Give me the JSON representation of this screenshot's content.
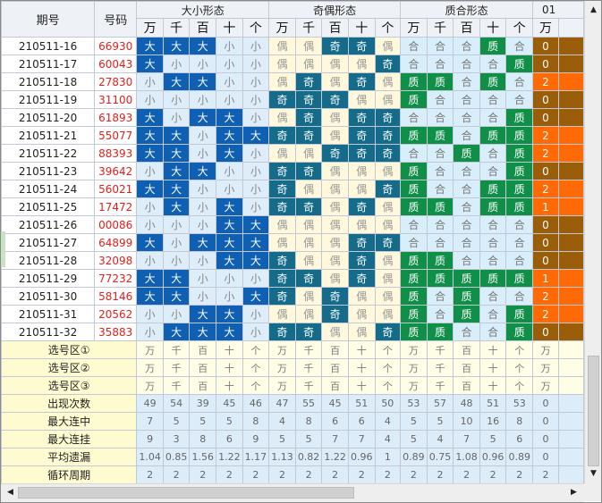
{
  "header": {
    "period": "期号",
    "number": "号码",
    "groups": [
      "大小形态",
      "奇偶形态",
      "质合形态",
      "01"
    ],
    "positions": [
      "万",
      "千",
      "百",
      "十",
      "个"
    ]
  },
  "rows": [
    {
      "p": "210511-16",
      "n": "66930",
      "dx": [
        "大",
        "大",
        "大",
        "小",
        "小"
      ],
      "jo": [
        "偶",
        "偶",
        "奇",
        "奇",
        "偶"
      ],
      "zh": [
        "合",
        "合",
        "合",
        "质",
        "合"
      ],
      "v": "0"
    },
    {
      "p": "210511-17",
      "n": "60043",
      "dx": [
        "大",
        "小",
        "小",
        "小",
        "小"
      ],
      "jo": [
        "偶",
        "偶",
        "偶",
        "偶",
        "奇"
      ],
      "zh": [
        "合",
        "合",
        "合",
        "合",
        "质"
      ],
      "v": "0"
    },
    {
      "p": "210511-18",
      "n": "27830",
      "dx": [
        "小",
        "大",
        "大",
        "小",
        "小"
      ],
      "jo": [
        "偶",
        "奇",
        "偶",
        "奇",
        "偶"
      ],
      "zh": [
        "质",
        "质",
        "合",
        "质",
        "合"
      ],
      "v": "2"
    },
    {
      "p": "210511-19",
      "n": "31100",
      "dx": [
        "小",
        "小",
        "小",
        "小",
        "小"
      ],
      "jo": [
        "奇",
        "奇",
        "奇",
        "偶",
        "偶"
      ],
      "zh": [
        "质",
        "合",
        "合",
        "合",
        "合"
      ],
      "v": "0"
    },
    {
      "p": "210511-20",
      "n": "61893",
      "dx": [
        "大",
        "小",
        "大",
        "大",
        "小"
      ],
      "jo": [
        "偶",
        "奇",
        "偶",
        "奇",
        "奇"
      ],
      "zh": [
        "合",
        "合",
        "合",
        "合",
        "质"
      ],
      "v": "0"
    },
    {
      "p": "210511-21",
      "n": "55077",
      "dx": [
        "大",
        "大",
        "小",
        "大",
        "大"
      ],
      "jo": [
        "奇",
        "奇",
        "偶",
        "奇",
        "奇"
      ],
      "zh": [
        "质",
        "质",
        "合",
        "质",
        "质"
      ],
      "v": "2"
    },
    {
      "p": "210511-22",
      "n": "88393",
      "dx": [
        "大",
        "大",
        "小",
        "大",
        "小"
      ],
      "jo": [
        "偶",
        "偶",
        "奇",
        "奇",
        "奇"
      ],
      "zh": [
        "合",
        "合",
        "质",
        "合",
        "质"
      ],
      "v": "2"
    },
    {
      "p": "210511-23",
      "n": "39642",
      "dx": [
        "小",
        "大",
        "大",
        "小",
        "小"
      ],
      "jo": [
        "奇",
        "奇",
        "偶",
        "偶",
        "偶"
      ],
      "zh": [
        "质",
        "合",
        "合",
        "合",
        "质"
      ],
      "v": "0"
    },
    {
      "p": "210511-24",
      "n": "56021",
      "dx": [
        "大",
        "大",
        "小",
        "小",
        "小"
      ],
      "jo": [
        "奇",
        "偶",
        "偶",
        "偶",
        "奇"
      ],
      "zh": [
        "质",
        "合",
        "合",
        "质",
        "质"
      ],
      "v": "2"
    },
    {
      "p": "210511-25",
      "n": "17472",
      "dx": [
        "小",
        "大",
        "小",
        "大",
        "小"
      ],
      "jo": [
        "奇",
        "奇",
        "偶",
        "奇",
        "偶"
      ],
      "zh": [
        "质",
        "质",
        "合",
        "质",
        "质"
      ],
      "v": "1"
    },
    {
      "p": "210511-26",
      "n": "00086",
      "dx": [
        "小",
        "小",
        "小",
        "大",
        "大"
      ],
      "jo": [
        "偶",
        "偶",
        "偶",
        "偶",
        "偶"
      ],
      "zh": [
        "合",
        "合",
        "合",
        "合",
        "合"
      ],
      "v": "0"
    },
    {
      "p": "210511-27",
      "n": "64899",
      "dx": [
        "大",
        "小",
        "大",
        "大",
        "大"
      ],
      "jo": [
        "偶",
        "偶",
        "偶",
        "奇",
        "奇"
      ],
      "zh": [
        "合",
        "合",
        "合",
        "合",
        "合"
      ],
      "v": "0"
    },
    {
      "p": "210511-28",
      "n": "32098",
      "dx": [
        "小",
        "小",
        "小",
        "大",
        "大"
      ],
      "jo": [
        "奇",
        "偶",
        "偶",
        "奇",
        "偶"
      ],
      "zh": [
        "质",
        "质",
        "合",
        "合",
        "合"
      ],
      "v": "0"
    },
    {
      "p": "210511-29",
      "n": "77232",
      "dx": [
        "大",
        "大",
        "小",
        "小",
        "小"
      ],
      "jo": [
        "奇",
        "奇",
        "偶",
        "奇",
        "偶"
      ],
      "zh": [
        "质",
        "质",
        "质",
        "质",
        "质"
      ],
      "v": "1"
    },
    {
      "p": "210511-30",
      "n": "58146",
      "dx": [
        "大",
        "大",
        "小",
        "小",
        "大"
      ],
      "jo": [
        "奇",
        "偶",
        "奇",
        "偶",
        "偶"
      ],
      "zh": [
        "质",
        "合",
        "质",
        "合",
        "合"
      ],
      "v": "2"
    },
    {
      "p": "210511-31",
      "n": "20562",
      "dx": [
        "小",
        "小",
        "大",
        "大",
        "小"
      ],
      "jo": [
        "偶",
        "偶",
        "奇",
        "偶",
        "偶"
      ],
      "zh": [
        "质",
        "合",
        "质",
        "合",
        "质"
      ],
      "v": "2"
    },
    {
      "p": "210511-32",
      "n": "35883",
      "dx": [
        "小",
        "大",
        "大",
        "大",
        "小"
      ],
      "jo": [
        "奇",
        "奇",
        "偶",
        "偶",
        "奇"
      ],
      "zh": [
        "质",
        "质",
        "合",
        "合",
        "质"
      ],
      "v": "0"
    }
  ],
  "footer": [
    {
      "label": "选号区①",
      "cells": [
        "万",
        "千",
        "百",
        "十",
        "个",
        "万",
        "千",
        "百",
        "十",
        "个",
        "万",
        "千",
        "百",
        "十",
        "个",
        "万"
      ]
    },
    {
      "label": "选号区②",
      "cells": [
        "万",
        "千",
        "百",
        "十",
        "个",
        "万",
        "千",
        "百",
        "十",
        "个",
        "万",
        "千",
        "百",
        "十",
        "个",
        "万"
      ]
    },
    {
      "label": "选号区③",
      "cells": [
        "万",
        "千",
        "百",
        "十",
        "个",
        "万",
        "千",
        "百",
        "十",
        "个",
        "万",
        "千",
        "百",
        "十",
        "个",
        "万"
      ]
    }
  ],
  "stats": [
    {
      "label": "出现次数",
      "cells": [
        "49",
        "54",
        "39",
        "45",
        "46",
        "47",
        "55",
        "45",
        "51",
        "50",
        "53",
        "57",
        "48",
        "51",
        "53",
        "0"
      ]
    },
    {
      "label": "最大连中",
      "cells": [
        "7",
        "5",
        "5",
        "5",
        "8",
        "4",
        "8",
        "6",
        "6",
        "4",
        "5",
        "5",
        "10",
        "16",
        "8",
        "0"
      ]
    },
    {
      "label": "最大连挂",
      "cells": [
        "9",
        "3",
        "8",
        "6",
        "9",
        "5",
        "5",
        "7",
        "7",
        "4",
        "5",
        "4",
        "7",
        "5",
        "6",
        "0"
      ]
    },
    {
      "label": "平均遗漏",
      "cells": [
        "1.04",
        "0.85",
        "1.56",
        "1.22",
        "1.17",
        "1.13",
        "0.82",
        "1.22",
        "0.96",
        "1",
        "0.89",
        "0.75",
        "1.08",
        "0.96",
        "0.89",
        "0"
      ]
    },
    {
      "label": "循环周期",
      "cells": [
        "2",
        "2",
        "2",
        "2",
        "2",
        "2",
        "2",
        "2",
        "2",
        "2",
        "2",
        "2",
        "2",
        "2",
        "2",
        "2"
      ]
    }
  ],
  "colors": {
    "big": "#0f5fb3",
    "odd": "#146b8a",
    "prime": "#108f48",
    "value0": "#9a5d0a",
    "value12": "#ff6a06"
  }
}
